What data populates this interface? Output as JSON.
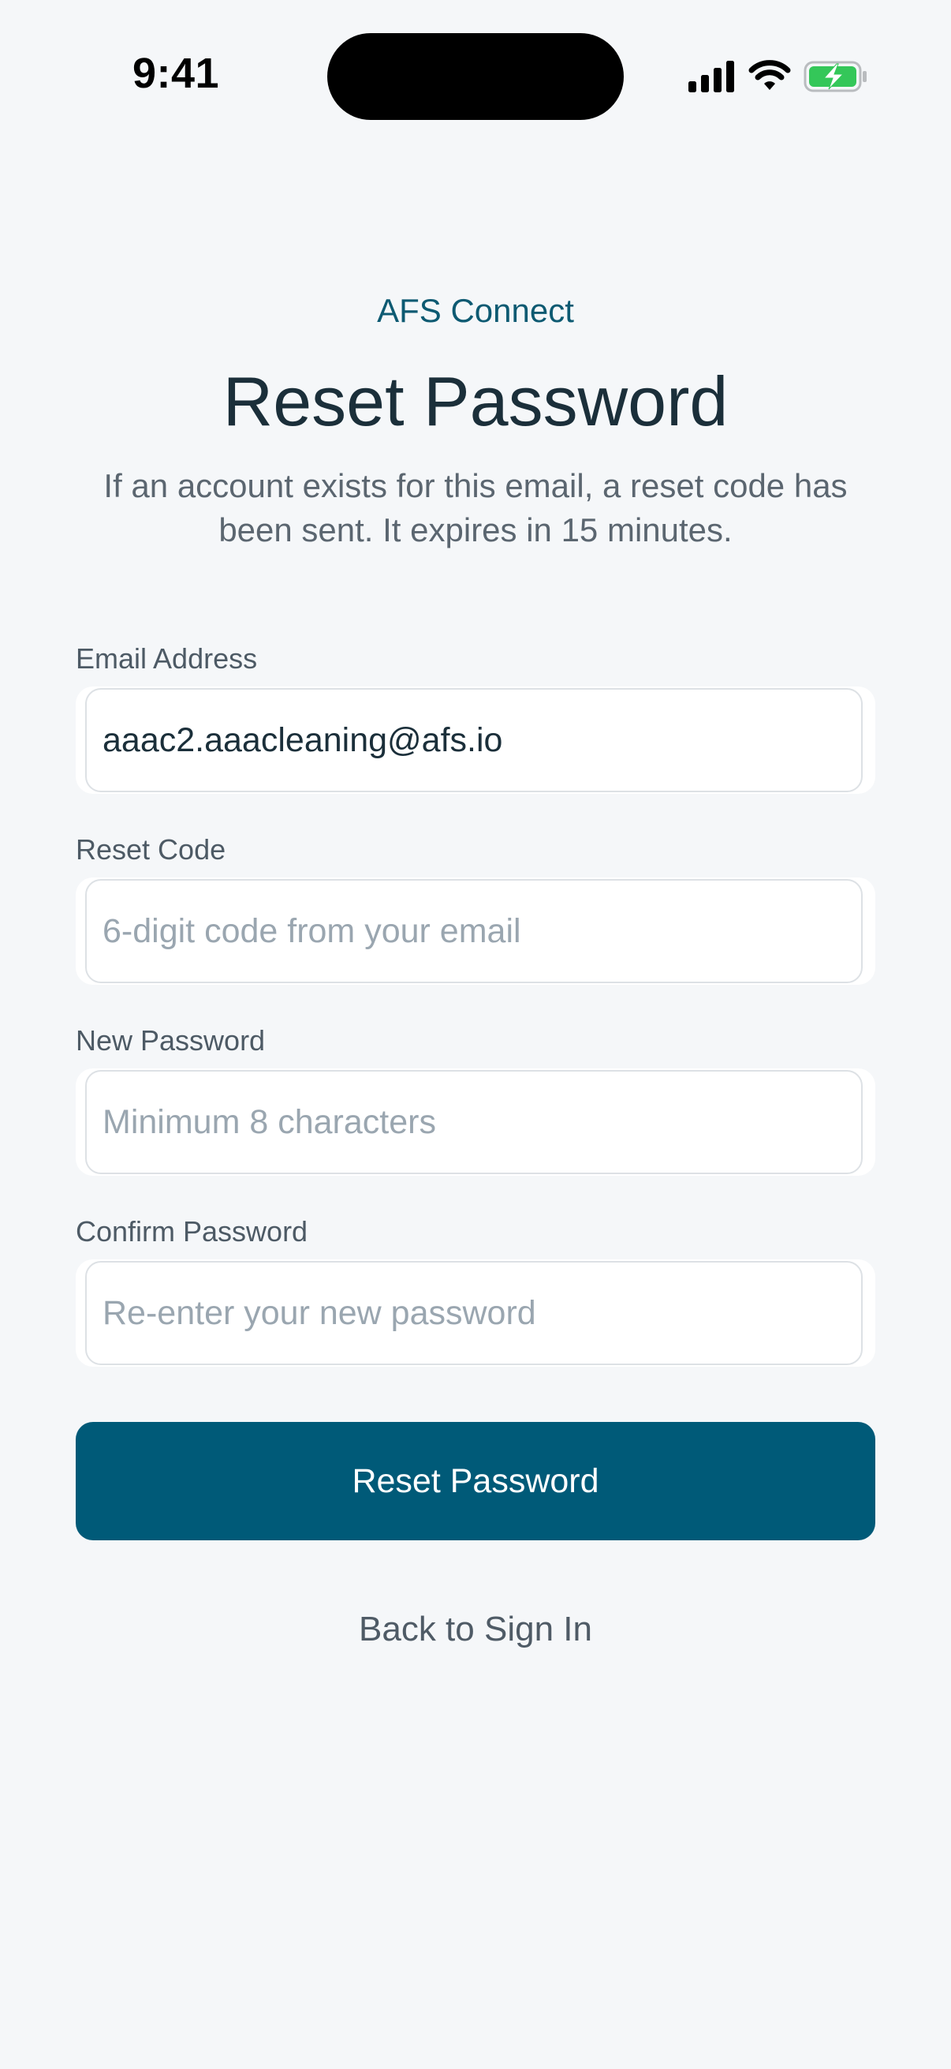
{
  "status_bar": {
    "time": "9:41",
    "icons": [
      "cellular-signal-icon",
      "wifi-icon",
      "battery-charging-icon"
    ],
    "battery_color": "#34c759"
  },
  "header": {
    "brand": "AFS Connect",
    "title": "Reset Password",
    "subtitle": "If an account exists for this email, a reset code has been sent. It expires in 15 minutes."
  },
  "form": {
    "email": {
      "label": "Email Address",
      "value": "aaac2.aaacleaning@afs.io",
      "placeholder": ""
    },
    "reset_code": {
      "label": "Reset Code",
      "value": "",
      "placeholder": "6-digit code from your email"
    },
    "new_password": {
      "label": "New Password",
      "value": "",
      "placeholder": "Minimum 8 characters"
    },
    "confirm_password": {
      "label": "Confirm Password",
      "value": "",
      "placeholder": "Re-enter your new password"
    },
    "submit_label": "Reset Password",
    "back_link": "Back to Sign In"
  },
  "colors": {
    "accent": "#005a78",
    "brand_text": "#0d5a72",
    "background": "#f5f7f9"
  }
}
